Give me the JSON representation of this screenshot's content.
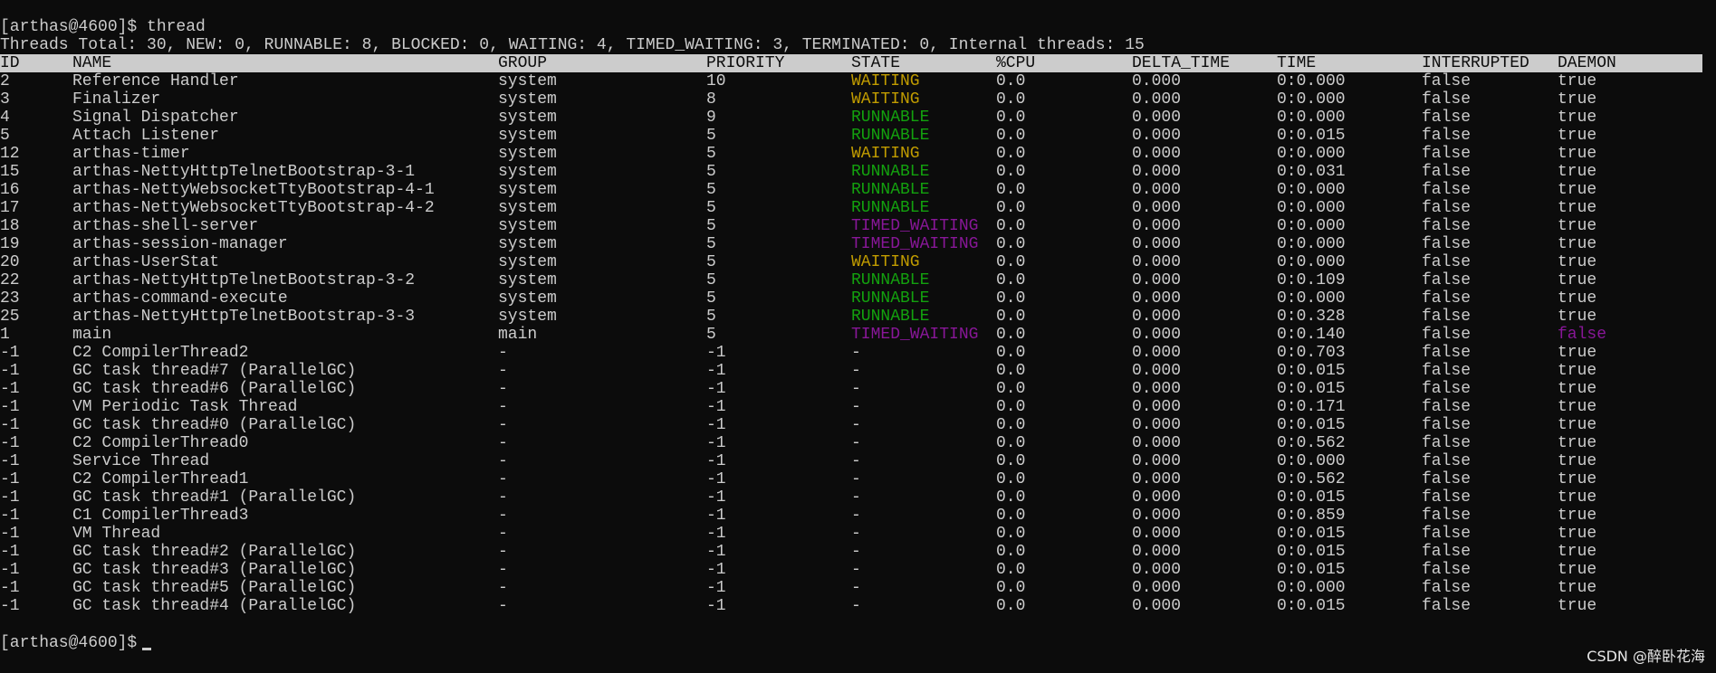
{
  "prompt": "[arthas@4600]$ ",
  "command": "thread",
  "summary": "Threads Total: 30, NEW: 0, RUNNABLE: 8, BLOCKED: 0, WAITING: 4, TIMED_WAITING: 3, TERMINATED: 0, Internal threads: 15",
  "colors": {
    "background": "#0c0c0c",
    "text": "#cccccc",
    "waiting": "#c19c00",
    "runnable": "#13a10e",
    "timed_waiting": "#881798"
  },
  "columns": [
    "ID",
    "NAME",
    "GROUP",
    "PRIORITY",
    "STATE",
    "%CPU",
    "DELTA_TIME",
    "TIME",
    "INTERRUPTED",
    "DAEMON"
  ],
  "rows": [
    [
      "2",
      "Reference Handler",
      "system",
      "10",
      "WAITING",
      "0.0",
      "0.000",
      "0:0.000",
      "false",
      "true"
    ],
    [
      "3",
      "Finalizer",
      "system",
      "8",
      "WAITING",
      "0.0",
      "0.000",
      "0:0.000",
      "false",
      "true"
    ],
    [
      "4",
      "Signal Dispatcher",
      "system",
      "9",
      "RUNNABLE",
      "0.0",
      "0.000",
      "0:0.000",
      "false",
      "true"
    ],
    [
      "5",
      "Attach Listener",
      "system",
      "5",
      "RUNNABLE",
      "0.0",
      "0.000",
      "0:0.015",
      "false",
      "true"
    ],
    [
      "12",
      "arthas-timer",
      "system",
      "5",
      "WAITING",
      "0.0",
      "0.000",
      "0:0.000",
      "false",
      "true"
    ],
    [
      "15",
      "arthas-NettyHttpTelnetBootstrap-3-1",
      "system",
      "5",
      "RUNNABLE",
      "0.0",
      "0.000",
      "0:0.031",
      "false",
      "true"
    ],
    [
      "16",
      "arthas-NettyWebsocketTtyBootstrap-4-1",
      "system",
      "5",
      "RUNNABLE",
      "0.0",
      "0.000",
      "0:0.000",
      "false",
      "true"
    ],
    [
      "17",
      "arthas-NettyWebsocketTtyBootstrap-4-2",
      "system",
      "5",
      "RUNNABLE",
      "0.0",
      "0.000",
      "0:0.000",
      "false",
      "true"
    ],
    [
      "18",
      "arthas-shell-server",
      "system",
      "5",
      "TIMED_WAITING",
      "0.0",
      "0.000",
      "0:0.000",
      "false",
      "true"
    ],
    [
      "19",
      "arthas-session-manager",
      "system",
      "5",
      "TIMED_WAITING",
      "0.0",
      "0.000",
      "0:0.000",
      "false",
      "true"
    ],
    [
      "20",
      "arthas-UserStat",
      "system",
      "5",
      "WAITING",
      "0.0",
      "0.000",
      "0:0.000",
      "false",
      "true"
    ],
    [
      "22",
      "arthas-NettyHttpTelnetBootstrap-3-2",
      "system",
      "5",
      "RUNNABLE",
      "0.0",
      "0.000",
      "0:0.109",
      "false",
      "true"
    ],
    [
      "23",
      "arthas-command-execute",
      "system",
      "5",
      "RUNNABLE",
      "0.0",
      "0.000",
      "0:0.000",
      "false",
      "true"
    ],
    [
      "25",
      "arthas-NettyHttpTelnetBootstrap-3-3",
      "system",
      "5",
      "RUNNABLE",
      "0.0",
      "0.000",
      "0:0.328",
      "false",
      "true"
    ],
    [
      "1",
      "main",
      "main",
      "5",
      "TIMED_WAITING",
      "0.0",
      "0.000",
      "0:0.140",
      "false",
      "false"
    ],
    [
      "-1",
      "C2 CompilerThread2",
      "-",
      "-1",
      "-",
      "0.0",
      "0.000",
      "0:0.703",
      "false",
      "true"
    ],
    [
      "-1",
      "GC task thread#7 (ParallelGC)",
      "-",
      "-1",
      "-",
      "0.0",
      "0.000",
      "0:0.015",
      "false",
      "true"
    ],
    [
      "-1",
      "GC task thread#6 (ParallelGC)",
      "-",
      "-1",
      "-",
      "0.0",
      "0.000",
      "0:0.015",
      "false",
      "true"
    ],
    [
      "-1",
      "VM Periodic Task Thread",
      "-",
      "-1",
      "-",
      "0.0",
      "0.000",
      "0:0.171",
      "false",
      "true"
    ],
    [
      "-1",
      "GC task thread#0 (ParallelGC)",
      "-",
      "-1",
      "-",
      "0.0",
      "0.000",
      "0:0.015",
      "false",
      "true"
    ],
    [
      "-1",
      "C2 CompilerThread0",
      "-",
      "-1",
      "-",
      "0.0",
      "0.000",
      "0:0.562",
      "false",
      "true"
    ],
    [
      "-1",
      "Service Thread",
      "-",
      "-1",
      "-",
      "0.0",
      "0.000",
      "0:0.000",
      "false",
      "true"
    ],
    [
      "-1",
      "C2 CompilerThread1",
      "-",
      "-1",
      "-",
      "0.0",
      "0.000",
      "0:0.562",
      "false",
      "true"
    ],
    [
      "-1",
      "GC task thread#1 (ParallelGC)",
      "-",
      "-1",
      "-",
      "0.0",
      "0.000",
      "0:0.015",
      "false",
      "true"
    ],
    [
      "-1",
      "C1 CompilerThread3",
      "-",
      "-1",
      "-",
      "0.0",
      "0.000",
      "0:0.859",
      "false",
      "true"
    ],
    [
      "-1",
      "VM Thread",
      "-",
      "-1",
      "-",
      "0.0",
      "0.000",
      "0:0.015",
      "false",
      "true"
    ],
    [
      "-1",
      "GC task thread#2 (ParallelGC)",
      "-",
      "-1",
      "-",
      "0.0",
      "0.000",
      "0:0.015",
      "false",
      "true"
    ],
    [
      "-1",
      "GC task thread#3 (ParallelGC)",
      "-",
      "-1",
      "-",
      "0.0",
      "0.000",
      "0:0.015",
      "false",
      "true"
    ],
    [
      "-1",
      "GC task thread#5 (ParallelGC)",
      "-",
      "-1",
      "-",
      "0.0",
      "0.000",
      "0:0.000",
      "false",
      "true"
    ],
    [
      "-1",
      "GC task thread#4 (ParallelGC)",
      "-",
      "-1",
      "-",
      "0.0",
      "0.000",
      "0:0.015",
      "false",
      "true"
    ]
  ],
  "final_prompt": "[arthas@4600]$",
  "watermark": "CSDN @醉卧花海"
}
